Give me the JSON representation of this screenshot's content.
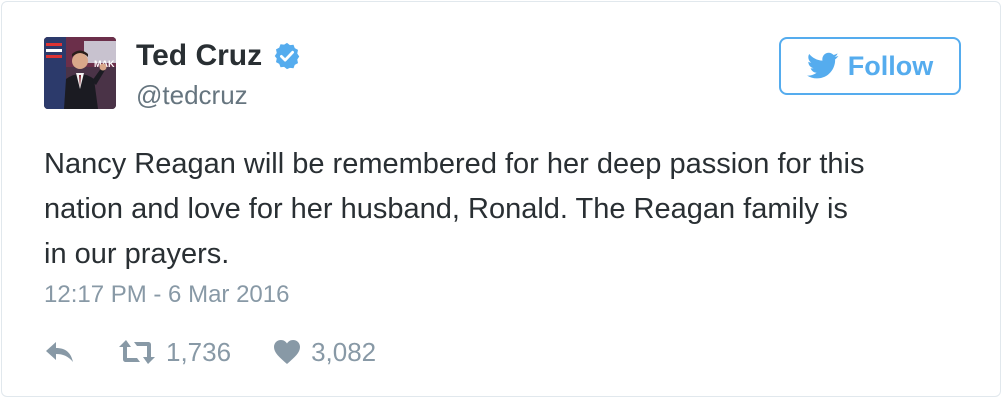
{
  "tweet": {
    "author": {
      "display_name": "Ted Cruz",
      "handle": "@tedcruz",
      "verified": true,
      "avatar_icon": "profile-photo"
    },
    "follow_button": {
      "label": "Follow",
      "icon": "twitter-bird-icon"
    },
    "text_lines": [
      "Nancy Reagan will be remembered for her deep passion for this",
      "nation and love for her husband, Ronald. The Reagan family is",
      "in our prayers."
    ],
    "timestamp": "12:17 PM - 6 Mar 2016",
    "actions": {
      "reply_icon": "reply-icon",
      "retweet_icon": "retweet-icon",
      "retweets": "1,736",
      "like_icon": "heart-icon",
      "likes": "3,082"
    }
  },
  "colors": {
    "accent": "#55acee",
    "text": "#292f33",
    "muted": "#8899a6",
    "handle": "#66757f",
    "border": "#e1e8ed"
  }
}
